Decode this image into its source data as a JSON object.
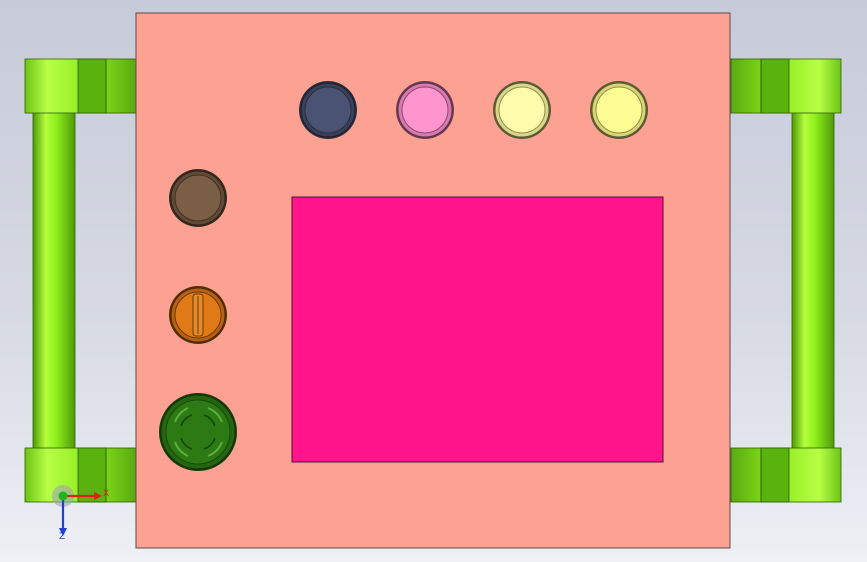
{
  "scene": {
    "background_top": "#c7cbd9",
    "background_bottom": "#eef0f5"
  },
  "panel": {
    "color": "#fda193",
    "edge_color": "#5b4a47"
  },
  "display_screen": {
    "color": "#ff148c"
  },
  "handles": {
    "color": "#8ef01a",
    "dark_color": "#4e9a0c"
  },
  "pilot_lights": [
    {
      "name": "dark-blue-indicator",
      "color": "#4a5373"
    },
    {
      "name": "pink-indicator",
      "color": "#ff94cf"
    },
    {
      "name": "light-yellow-indicator-1",
      "color": "#fcfcaa"
    },
    {
      "name": "light-yellow-indicator-2",
      "color": "#fcfc92"
    }
  ],
  "side_controls": [
    {
      "name": "brown-indicator",
      "color": "#7a5e45"
    },
    {
      "name": "orange-selector-switch",
      "color": "#e07a17"
    },
    {
      "name": "green-mushroom-button",
      "color": "#2d7a14"
    }
  ],
  "axis_triad": {
    "x_label": "X",
    "y_label": "Y",
    "z_label": "Z",
    "x_color": "#e0201b",
    "y_color": "#19b41e",
    "z_color": "#1f3fd6"
  }
}
